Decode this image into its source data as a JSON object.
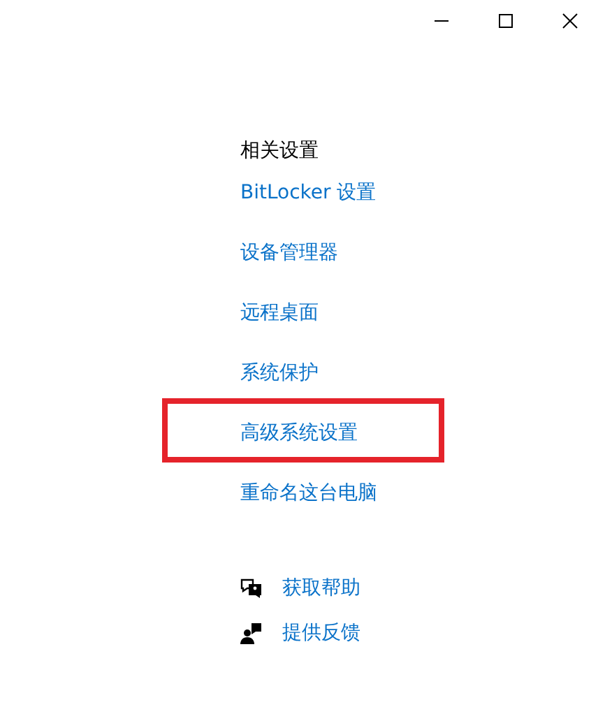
{
  "window_controls": [
    {
      "kind": "minimize"
    },
    {
      "kind": "maximize"
    },
    {
      "kind": "close"
    }
  ],
  "related_settings": {
    "heading": "相关设置",
    "links": [
      {
        "label": "BitLocker 设置",
        "highlighted": false
      },
      {
        "label": "设备管理器",
        "highlighted": false
      },
      {
        "label": "远程桌面",
        "highlighted": false
      },
      {
        "label": "系统保护",
        "highlighted": false
      },
      {
        "label": "高级系统设置",
        "highlighted": true
      },
      {
        "label": "重命名这台电脑",
        "highlighted": false
      }
    ]
  },
  "support_links": [
    {
      "kind": "help",
      "label": "获取帮助"
    },
    {
      "kind": "feedback",
      "label": "提供反馈"
    }
  ]
}
